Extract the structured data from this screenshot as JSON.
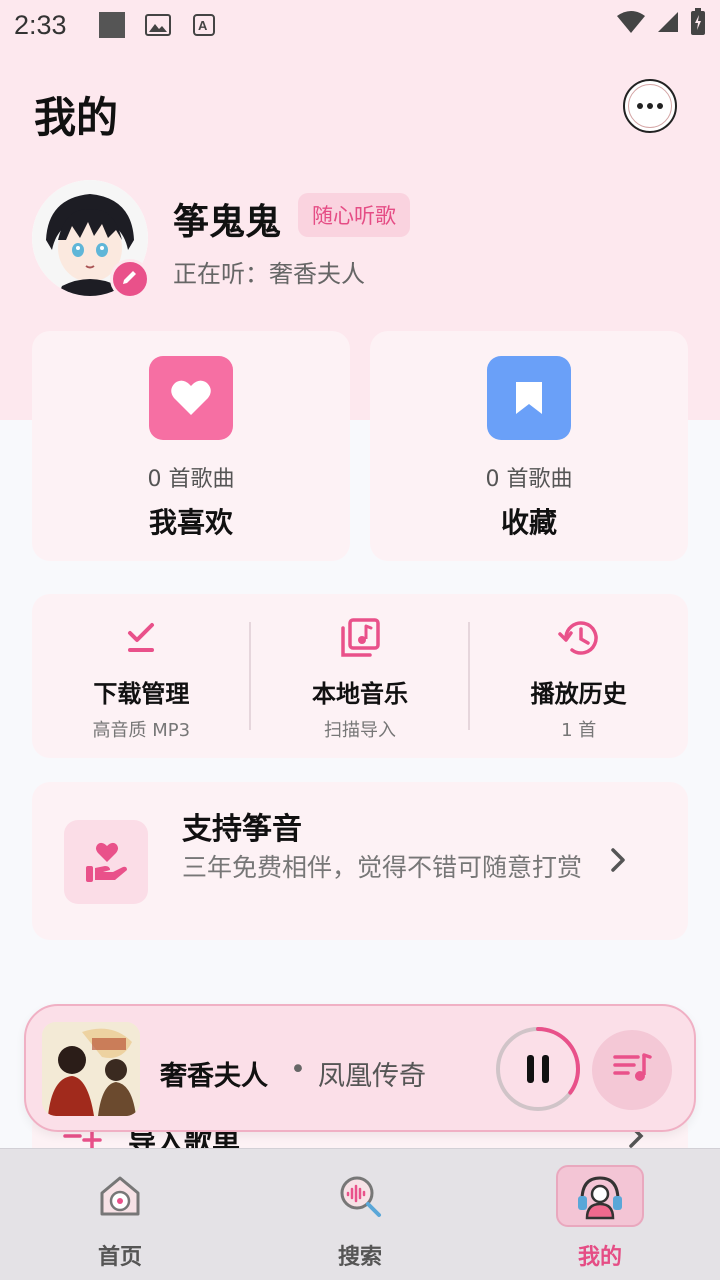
{
  "status_bar": {
    "time": "2:33",
    "icons": [
      "square-icon",
      "image-icon",
      "font-icon"
    ],
    "right_icons": [
      "wifi-icon",
      "signal-icon",
      "battery-icon"
    ]
  },
  "header": {
    "title": "我的",
    "more_icon": "more-horizontal-icon"
  },
  "profile": {
    "name": "筝鬼鬼",
    "tag": "随心听歌",
    "now_playing": "正在听：奢香夫人"
  },
  "collections": [
    {
      "count": "0 首歌曲",
      "label": "我喜欢",
      "icon": "heart-icon",
      "color": "#f66fa3"
    },
    {
      "count": "0 首歌曲",
      "label": "收藏",
      "icon": "bookmark-icon",
      "color": "#6aa0f8"
    }
  ],
  "tools": [
    {
      "name": "下载管理",
      "sub": "高音质 MP3",
      "icon": "download-check-icon"
    },
    {
      "name": "本地音乐",
      "sub": "扫描导入",
      "icon": "music-library-icon"
    },
    {
      "name": "播放历史",
      "sub": "1 首",
      "icon": "history-icon"
    }
  ],
  "support": {
    "title": "支持筝音",
    "desc": "三年免费相伴，觉得不错可随意打赏",
    "icon": "hand-heart-icon"
  },
  "import": {
    "label": "导入歌单"
  },
  "player": {
    "song": "奢香夫人",
    "separator": "•",
    "album": "凤凰传奇",
    "progress": 0.35
  },
  "nav": [
    {
      "label": "首页",
      "icon": "home-record-icon",
      "active": false
    },
    {
      "label": "搜索",
      "icon": "search-wave-icon",
      "active": false
    },
    {
      "label": "我的",
      "icon": "headphone-user-icon",
      "active": true
    }
  ],
  "colors": {
    "accent": "#e54d85",
    "header_bg": "#fde8ee"
  }
}
